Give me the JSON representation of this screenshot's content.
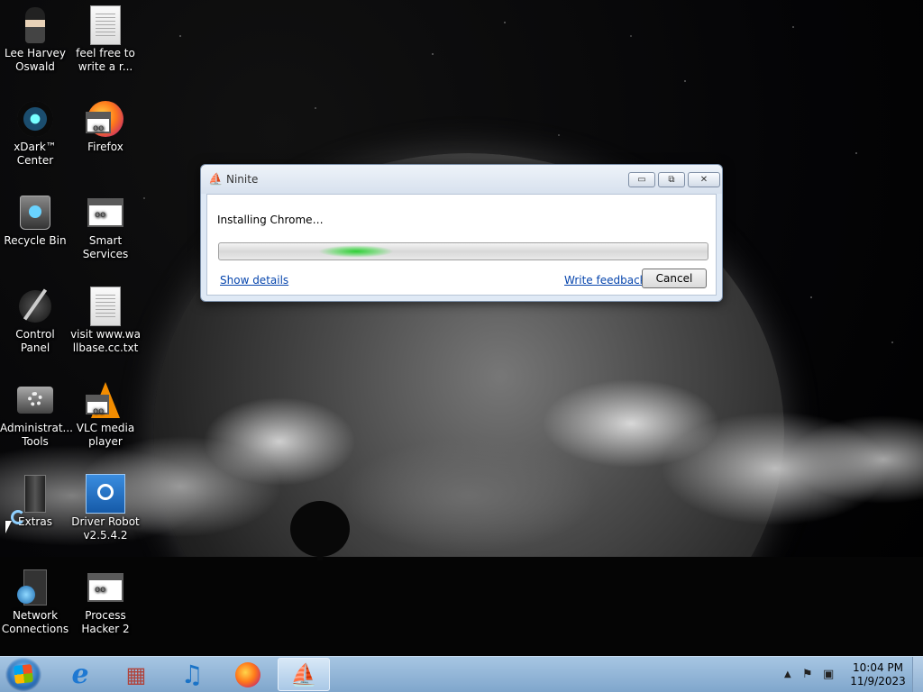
{
  "desktop": {
    "icons": [
      {
        "label": "Lee Harvey Oswald",
        "icon": "person-figure-icon"
      },
      {
        "label": "feel free to write a r...",
        "icon": "text-document-icon"
      },
      {
        "label": "xDark™ Center",
        "icon": "xdark-orb-icon"
      },
      {
        "label": "Firefox",
        "icon": "firefox-icon"
      },
      {
        "label": "Recycle Bin",
        "icon": "recycle-bin-icon"
      },
      {
        "label": "Smart Services",
        "icon": "services-gear-icon"
      },
      {
        "label": "Control Panel",
        "icon": "control-panel-icon"
      },
      {
        "label": "visit www.wallbase.cc.txt",
        "icon": "text-document-icon"
      },
      {
        "label": "Administrat... Tools",
        "icon": "admin-tools-icon"
      },
      {
        "label": "VLC media player",
        "icon": "vlc-cone-icon"
      },
      {
        "label": "Extras",
        "icon": "folder-icon"
      },
      {
        "label": "Driver Robot v2.5.4.2",
        "icon": "driver-robot-icon"
      },
      {
        "label": "Network Connections",
        "icon": "network-globe-icon"
      },
      {
        "label": "Process Hacker 2",
        "icon": "process-hacker-icon"
      }
    ]
  },
  "dialog": {
    "title": "Ninite",
    "status": "Installing Chrome…",
    "progress": 0.28,
    "show_details": "Show details",
    "write_feedback": "Write feedback",
    "cancel": "Cancel",
    "minimize_glyph": "▭",
    "maximize_glyph": "⧉",
    "close_glyph": "✕"
  },
  "taskbar": {
    "pinned": [
      {
        "name": "internet-explorer",
        "glyph": "e",
        "color": "#1e78d2"
      },
      {
        "name": "windows-media-center",
        "glyph": "▦",
        "color": "#b0423a"
      },
      {
        "name": "itunes",
        "glyph": "♫",
        "color": "#1a73c7"
      },
      {
        "name": "firefox",
        "glyph": "◉",
        "color": "#e8741c"
      },
      {
        "name": "ninite",
        "glyph": "⛵",
        "color": "#2d5fbf"
      }
    ],
    "clock_time": "10:04 PM",
    "clock_date": "11/9/2023"
  }
}
